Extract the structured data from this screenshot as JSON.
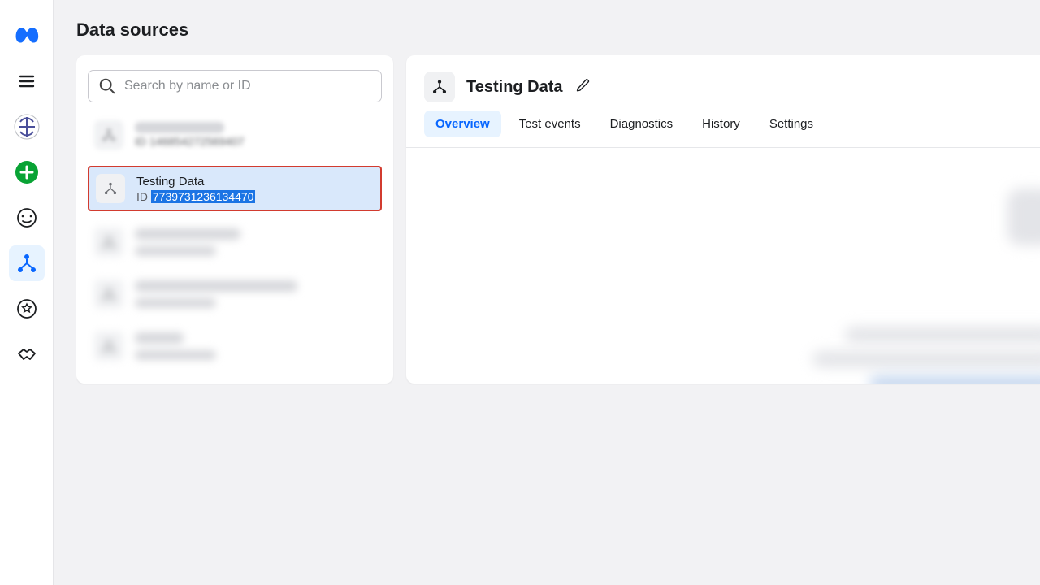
{
  "page": {
    "title": "Data sources"
  },
  "search": {
    "placeholder": "Search by name or ID"
  },
  "list": {
    "first_blur_id": "ID 146854272569407",
    "selected": {
      "name": "Testing Data",
      "id_prefix": "ID ",
      "id_value": "7739731236134470"
    }
  },
  "detail": {
    "title": "Testing Data",
    "tabs": {
      "overview": "Overview",
      "test_events": "Test events",
      "diagnostics": "Diagnostics",
      "history": "History",
      "settings": "Settings"
    }
  },
  "leftrail": {
    "icons": [
      "logo",
      "menu",
      "business",
      "add",
      "gauge",
      "data-sources",
      "favorites",
      "partner"
    ]
  }
}
